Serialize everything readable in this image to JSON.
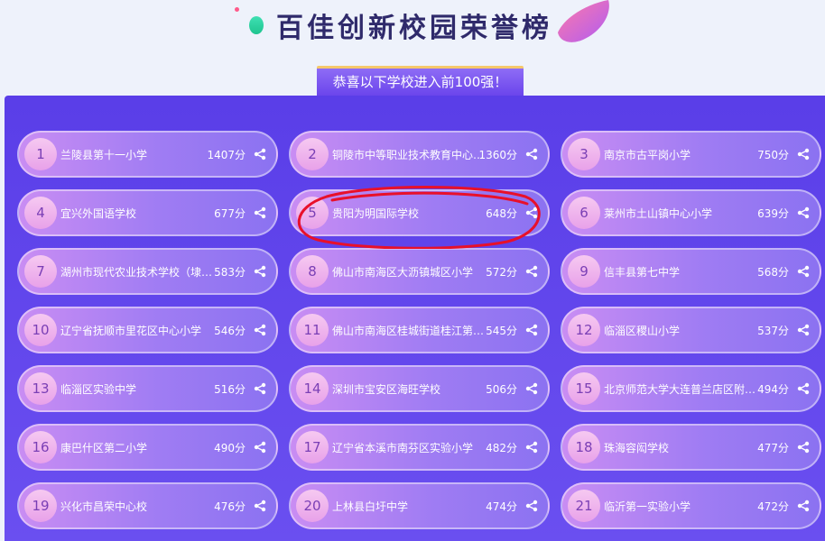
{
  "header": {
    "title": "百佳创新校园荣誉榜",
    "banner": "恭喜以下学校进入前100强！"
  },
  "colors": {
    "panel": "#5a3ee8",
    "card_gradient_start": "#c98df3",
    "card_gradient_end": "#8b72f1",
    "title": "#2f2a6b",
    "highlight_circle": "#e8102a"
  },
  "schools": [
    {
      "rank": "1",
      "name": "兰陵县第十一小学",
      "score": "1407分"
    },
    {
      "rank": "2",
      "name": "铜陵市中等职业技术教育中心（安…",
      "score": "1360分"
    },
    {
      "rank": "3",
      "name": "南京市古平岗小学",
      "score": "750分"
    },
    {
      "rank": "4",
      "name": "宜兴外国语学校",
      "score": "677分"
    },
    {
      "rank": "5",
      "name": "贵阳为明国际学校",
      "score": "648分"
    },
    {
      "rank": "6",
      "name": "莱州市土山镇中心小学",
      "score": "639分"
    },
    {
      "rank": "7",
      "name": "湖州市现代农业技术学校（埭溪中…",
      "score": "583分"
    },
    {
      "rank": "8",
      "name": "佛山市南海区大沥镇城区小学",
      "score": "572分"
    },
    {
      "rank": "9",
      "name": "信丰县第七中学",
      "score": "568分"
    },
    {
      "rank": "10",
      "name": "辽宁省抚顺市里花区中心小学",
      "score": "546分"
    },
    {
      "rank": "11",
      "name": "佛山市南海区桂城街道桂江第二小学",
      "score": "545分"
    },
    {
      "rank": "12",
      "name": "临淄区稷山小学",
      "score": "537分"
    },
    {
      "rank": "13",
      "name": "临淄区实验中学",
      "score": "516分"
    },
    {
      "rank": "14",
      "name": "深圳市宝安区海旺学校",
      "score": "506分"
    },
    {
      "rank": "15",
      "name": "北京师范大学大连普兰店区附属学校",
      "score": "494分"
    },
    {
      "rank": "16",
      "name": "康巴什区第二小学",
      "score": "490分"
    },
    {
      "rank": "17",
      "name": "辽宁省本溪市南芬区实验小学",
      "score": "482分"
    },
    {
      "rank": "18",
      "name": "珠海容闳学校",
      "score": "477分"
    },
    {
      "rank": "19",
      "name": "兴化市昌荣中心校",
      "score": "476分"
    },
    {
      "rank": "20",
      "name": "上林县白圩中学",
      "score": "474分"
    },
    {
      "rank": "21",
      "name": "临沂第一实验小学",
      "score": "472分"
    }
  ]
}
